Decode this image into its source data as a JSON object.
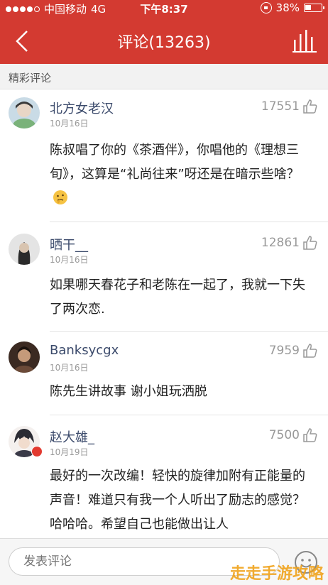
{
  "status_bar": {
    "carrier": "中国移动",
    "network": "4G",
    "time": "下午8:37",
    "battery": "38%"
  },
  "nav": {
    "title": "评论(13263)"
  },
  "section": {
    "title": "精彩评论"
  },
  "comments": [
    {
      "user": "北方女老汉",
      "date": "10月16日",
      "likes": "17551",
      "text": "陈叔唱了你的《茶酒伴》，你唱他的《理想三旬》，这算是“礼尚往来”呀还是在暗示些啥？"
    },
    {
      "user": "晒干__",
      "date": "10月16日",
      "likes": "12861",
      "text": "如果哪天春花子和老陈在一起了，我就一下失了两次恋."
    },
    {
      "user": "Banksycgx",
      "date": "10月16日",
      "likes": "7959",
      "text": "陈先生讲故事 谢小姐玩洒脱"
    },
    {
      "user": "赵大雄_",
      "date": "10月19日",
      "likes": "7500",
      "text": "最好的一次改编！轻快的旋律加附有正能量的声音！难道只有我一个人听出了励志的感觉？哈哈哈。希望自己也能做出让人"
    }
  ],
  "bottom": {
    "input_placeholder": "发表评论"
  },
  "watermark": "走走手游攻略",
  "colors": {
    "brand_red": "#d33a31",
    "username_blue": "#3b4a6b"
  }
}
